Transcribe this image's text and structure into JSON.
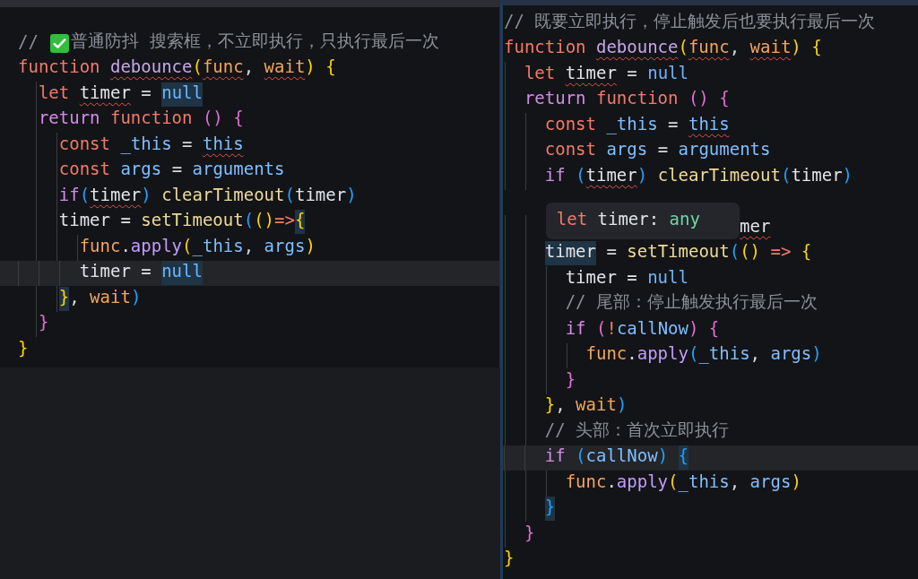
{
  "editors": [
    {
      "lines": [
        {
          "current": false,
          "tokens": [
            {
              "text": "// ",
              "kind": "comment",
              "squiggle": false,
              "highlighted": false
            },
            {
              "kind": "check",
              "squiggle": false,
              "highlighted": false
            },
            {
              "text": "普通防抖 搜索框，不立即执行，只执行最后一次",
              "kind": "comment",
              "squiggle": false,
              "highlighted": false
            }
          ]
        },
        {
          "current": false,
          "tokens": [
            {
              "text": "function ",
              "kind": "keyword",
              "squiggle": false,
              "highlighted": false
            },
            {
              "text": "debounce",
              "kind": "function",
              "squiggle": true,
              "highlighted": false
            },
            {
              "text": "(",
              "kind": "bracket1",
              "squiggle": false,
              "highlighted": false
            },
            {
              "text": "func",
              "kind": "param",
              "squiggle": true,
              "highlighted": false
            },
            {
              "text": ", ",
              "kind": "punct",
              "squiggle": false,
              "highlighted": false
            },
            {
              "text": "wait",
              "kind": "param",
              "squiggle": true,
              "highlighted": false
            },
            {
              "text": ") ",
              "kind": "bracket1",
              "squiggle": false,
              "highlighted": false
            },
            {
              "text": "{",
              "kind": "bracket1",
              "squiggle": false,
              "highlighted": false
            }
          ]
        },
        {
          "current": false,
          "tokens": [
            {
              "text": "  let ",
              "kind": "keyword",
              "squiggle": false,
              "highlighted": false
            },
            {
              "text": "timer",
              "kind": "variable",
              "squiggle": true,
              "highlighted": false
            },
            {
              "text": " = ",
              "kind": "punct",
              "squiggle": false,
              "highlighted": false
            },
            {
              "text": "null",
              "kind": "constant",
              "squiggle": false,
              "highlighted": true
            }
          ]
        },
        {
          "current": false,
          "tokens": [
            {
              "text": "  return ",
              "kind": "control",
              "squiggle": false,
              "highlighted": false
            },
            {
              "text": "function ",
              "kind": "keyword",
              "squiggle": false,
              "highlighted": false
            },
            {
              "text": "() ",
              "kind": "bracket2",
              "squiggle": false,
              "highlighted": false
            },
            {
              "text": "{",
              "kind": "bracket2",
              "squiggle": false,
              "highlighted": false
            }
          ]
        },
        {
          "current": false,
          "tokens": [
            {
              "text": "    const ",
              "kind": "keyword",
              "squiggle": false,
              "highlighted": false
            },
            {
              "text": "_this",
              "kind": "argument",
              "squiggle": false,
              "highlighted": false
            },
            {
              "text": " = ",
              "kind": "punct",
              "squiggle": false,
              "highlighted": false
            },
            {
              "text": "this",
              "kind": "argument",
              "squiggle": true,
              "highlighted": false
            }
          ]
        },
        {
          "current": false,
          "tokens": [
            {
              "text": "    const ",
              "kind": "keyword",
              "squiggle": false,
              "highlighted": false
            },
            {
              "text": "args",
              "kind": "argument",
              "squiggle": false,
              "highlighted": false
            },
            {
              "text": " = ",
              "kind": "punct",
              "squiggle": false,
              "highlighted": false
            },
            {
              "text": "arguments",
              "kind": "argument",
              "squiggle": false,
              "highlighted": false
            }
          ]
        },
        {
          "current": false,
          "tokens": [
            {
              "text": "    if",
              "kind": "control",
              "squiggle": false,
              "highlighted": false
            },
            {
              "text": "(",
              "kind": "bracket3",
              "squiggle": false,
              "highlighted": false
            },
            {
              "text": "timer",
              "kind": "variable",
              "squiggle": true,
              "highlighted": false
            },
            {
              "text": ") ",
              "kind": "bracket3",
              "squiggle": false,
              "highlighted": false
            },
            {
              "text": "clearTimeout",
              "kind": "call",
              "squiggle": false,
              "highlighted": false
            },
            {
              "text": "(",
              "kind": "bracket3",
              "squiggle": false,
              "highlighted": false
            },
            {
              "text": "timer",
              "kind": "variable",
              "squiggle": false,
              "highlighted": false
            },
            {
              "text": ")",
              "kind": "bracket3",
              "squiggle": false,
              "highlighted": false
            }
          ]
        },
        {
          "current": false,
          "tokens": [
            {
              "text": "    timer = ",
              "kind": "variable",
              "squiggle": false,
              "highlighted": false
            },
            {
              "text": "setTimeout",
              "kind": "call",
              "squiggle": false,
              "highlighted": false
            },
            {
              "text": "(",
              "kind": "bracket3",
              "squiggle": false,
              "highlighted": false
            },
            {
              "text": "()",
              "kind": "bracket1",
              "squiggle": false,
              "highlighted": false
            },
            {
              "text": "=>",
              "kind": "keyword",
              "squiggle": false,
              "highlighted": false
            },
            {
              "text": "{",
              "kind": "bracket1",
              "squiggle": false,
              "highlighted": true
            }
          ]
        },
        {
          "current": false,
          "tokens": [
            {
              "text": "      func",
              "kind": "param",
              "squiggle": false,
              "highlighted": false
            },
            {
              "text": ".",
              "kind": "punct",
              "squiggle": false,
              "highlighted": false
            },
            {
              "text": "apply",
              "kind": "method",
              "squiggle": false,
              "highlighted": false
            },
            {
              "text": "(",
              "kind": "bracket1",
              "squiggle": false,
              "highlighted": false
            },
            {
              "text": "_this",
              "kind": "argument",
              "squiggle": false,
              "highlighted": false
            },
            {
              "text": ", ",
              "kind": "punct",
              "squiggle": false,
              "highlighted": false
            },
            {
              "text": "args",
              "kind": "argument",
              "squiggle": false,
              "highlighted": false
            },
            {
              "text": ")",
              "kind": "bracket1",
              "squiggle": false,
              "highlighted": false
            }
          ]
        },
        {
          "current": true,
          "tokens": [
            {
              "text": "      timer = ",
              "kind": "variable",
              "squiggle": false,
              "highlighted": false
            },
            {
              "text": "null",
              "kind": "constant",
              "squiggle": false,
              "highlighted": true
            }
          ]
        },
        {
          "current": false,
          "tokens": [
            {
              "text": "    }",
              "kind": "bracket1",
              "squiggle": false,
              "highlighted": true
            },
            {
              "text": ", ",
              "kind": "punct",
              "squiggle": false,
              "highlighted": false
            },
            {
              "text": "wait",
              "kind": "param",
              "squiggle": false,
              "highlighted": false
            },
            {
              "text": ")",
              "kind": "bracket3",
              "squiggle": false,
              "highlighted": false
            }
          ]
        },
        {
          "current": false,
          "tokens": [
            {
              "text": "  }",
              "kind": "bracket2",
              "squiggle": false,
              "highlighted": false
            }
          ]
        },
        {
          "current": false,
          "tokens": [
            {
              "text": "}",
              "kind": "bracket1",
              "squiggle": false,
              "highlighted": false
            }
          ]
        }
      ]
    },
    {
      "lines": [
        {
          "current": false,
          "tokens": [
            {
              "text": "// 既要立即执行，停止触发后也要执行最后一次",
              "kind": "comment",
              "squiggle": false,
              "highlighted": false
            }
          ]
        },
        {
          "current": false,
          "tokens": [
            {
              "text": "function ",
              "kind": "keyword",
              "squiggle": false,
              "highlighted": false
            },
            {
              "text": "debounce",
              "kind": "function",
              "squiggle": true,
              "highlighted": false
            },
            {
              "text": "(",
              "kind": "bracket1",
              "squiggle": false,
              "highlighted": false
            },
            {
              "text": "func",
              "kind": "param",
              "squiggle": true,
              "highlighted": false
            },
            {
              "text": ", ",
              "kind": "punct",
              "squiggle": false,
              "highlighted": false
            },
            {
              "text": "wait",
              "kind": "param",
              "squiggle": true,
              "highlighted": false
            },
            {
              "text": ") ",
              "kind": "bracket1",
              "squiggle": false,
              "highlighted": false
            },
            {
              "text": "{",
              "kind": "bracket1",
              "squiggle": false,
              "highlighted": false
            }
          ]
        },
        {
          "current": false,
          "tokens": [
            {
              "text": "  let ",
              "kind": "keyword",
              "squiggle": false,
              "highlighted": false
            },
            {
              "text": "timer",
              "kind": "variable",
              "squiggle": true,
              "highlighted": false
            },
            {
              "text": " = ",
              "kind": "punct",
              "squiggle": false,
              "highlighted": false
            },
            {
              "text": "null",
              "kind": "constant",
              "squiggle": false,
              "highlighted": false
            }
          ]
        },
        {
          "current": false,
          "tokens": [
            {
              "text": "  return ",
              "kind": "control",
              "squiggle": false,
              "highlighted": false
            },
            {
              "text": "function ",
              "kind": "keyword",
              "squiggle": false,
              "highlighted": false
            },
            {
              "text": "() ",
              "kind": "bracket2",
              "squiggle": false,
              "highlighted": false
            },
            {
              "text": "{",
              "kind": "bracket2",
              "squiggle": false,
              "highlighted": false
            }
          ]
        },
        {
          "current": false,
          "tokens": [
            {
              "text": "    const ",
              "kind": "keyword",
              "squiggle": false,
              "highlighted": false
            },
            {
              "text": "_this",
              "kind": "argument",
              "squiggle": false,
              "highlighted": false
            },
            {
              "text": " = ",
              "kind": "punct",
              "squiggle": false,
              "highlighted": false
            },
            {
              "text": "this",
              "kind": "argument",
              "squiggle": true,
              "highlighted": false
            }
          ]
        },
        {
          "current": false,
          "tokens": [
            {
              "text": "    const ",
              "kind": "keyword",
              "squiggle": false,
              "highlighted": false
            },
            {
              "text": "args",
              "kind": "argument",
              "squiggle": false,
              "highlighted": false
            },
            {
              "text": " = ",
              "kind": "punct",
              "squiggle": false,
              "highlighted": false
            },
            {
              "text": "arguments",
              "kind": "argument",
              "squiggle": false,
              "highlighted": false
            }
          ]
        },
        {
          "current": false,
          "tokens": [
            {
              "text": "    if ",
              "kind": "control",
              "squiggle": false,
              "highlighted": false
            },
            {
              "text": "(",
              "kind": "bracket3",
              "squiggle": false,
              "highlighted": false
            },
            {
              "text": "timer",
              "kind": "variable",
              "squiggle": true,
              "highlighted": false
            },
            {
              "text": ") ",
              "kind": "bracket3",
              "squiggle": false,
              "highlighted": false
            },
            {
              "text": "clearTimeout",
              "kind": "call",
              "squiggle": false,
              "highlighted": false
            },
            {
              "text": "(",
              "kind": "bracket3",
              "squiggle": false,
              "highlighted": false
            },
            {
              "text": "timer",
              "kind": "variable",
              "squiggle": false,
              "highlighted": false
            },
            {
              "text": ")",
              "kind": "bracket3",
              "squiggle": false,
              "highlighted": false
            }
          ]
        },
        {
          "current": false
        },
        {
          "current": false,
          "tooltip": [
            {
              "text": "let ",
              "kind": "keyword"
            },
            {
              "text": "timer: ",
              "kind": "variable"
            },
            {
              "text": "any",
              "kind": "type"
            }
          ],
          "tokens": [
            {
              "text": "                       mer",
              "kind": "variable",
              "squiggle": true,
              "highlighted": false
            }
          ]
        },
        {
          "current": false,
          "tokens": [
            {
              "text": "    timer",
              "kind": "variable",
              "squiggle": false,
              "highlighted": true
            },
            {
              "text": " = ",
              "kind": "punct",
              "squiggle": false,
              "highlighted": false
            },
            {
              "text": "setTimeout",
              "kind": "call",
              "squiggle": false,
              "highlighted": false
            },
            {
              "text": "(",
              "kind": "bracket3",
              "squiggle": false,
              "highlighted": false
            },
            {
              "text": "() ",
              "kind": "bracket1",
              "squiggle": false,
              "highlighted": false
            },
            {
              "text": "=> ",
              "kind": "keyword",
              "squiggle": false,
              "highlighted": false
            },
            {
              "text": "{",
              "kind": "bracket1",
              "squiggle": false,
              "highlighted": false
            }
          ]
        },
        {
          "current": false,
          "tokens": [
            {
              "text": "      timer = ",
              "kind": "variable",
              "squiggle": false,
              "highlighted": false
            },
            {
              "text": "null",
              "kind": "constant",
              "squiggle": false,
              "highlighted": false
            }
          ]
        },
        {
          "current": false,
          "tokens": [
            {
              "text": "      // 尾部：停止触发执行最后一次",
              "kind": "comment",
              "squiggle": false,
              "highlighted": false
            }
          ]
        },
        {
          "current": false,
          "tokens": [
            {
              "text": "      if ",
              "kind": "control",
              "squiggle": false,
              "highlighted": false
            },
            {
              "text": "(",
              "kind": "bracket2",
              "squiggle": false,
              "highlighted": false
            },
            {
              "text": "!",
              "kind": "keyword",
              "squiggle": false,
              "highlighted": false
            },
            {
              "text": "callNow",
              "kind": "argument",
              "squiggle": false,
              "highlighted": false
            },
            {
              "text": ") ",
              "kind": "bracket2",
              "squiggle": false,
              "highlighted": false
            },
            {
              "text": "{",
              "kind": "bracket2",
              "squiggle": false,
              "highlighted": false
            }
          ]
        },
        {
          "current": false,
          "tokens": [
            {
              "text": "        func",
              "kind": "param",
              "squiggle": false,
              "highlighted": false
            },
            {
              "text": ".",
              "kind": "punct",
              "squiggle": false,
              "highlighted": false
            },
            {
              "text": "apply",
              "kind": "method",
              "squiggle": false,
              "highlighted": false
            },
            {
              "text": "(",
              "kind": "bracket3",
              "squiggle": false,
              "highlighted": false
            },
            {
              "text": "_this",
              "kind": "argument",
              "squiggle": false,
              "highlighted": false
            },
            {
              "text": ", ",
              "kind": "punct",
              "squiggle": false,
              "highlighted": false
            },
            {
              "text": "args",
              "kind": "argument",
              "squiggle": false,
              "highlighted": false
            },
            {
              "text": ")",
              "kind": "bracket3",
              "squiggle": false,
              "highlighted": false
            }
          ]
        },
        {
          "current": false,
          "tokens": [
            {
              "text": "      }",
              "kind": "bracket2",
              "squiggle": false,
              "highlighted": false
            }
          ]
        },
        {
          "current": false,
          "tokens": [
            {
              "text": "    }",
              "kind": "bracket1",
              "squiggle": false,
              "highlighted": false
            },
            {
              "text": ", ",
              "kind": "punct",
              "squiggle": false,
              "highlighted": false
            },
            {
              "text": "wait",
              "kind": "param",
              "squiggle": false,
              "highlighted": false
            },
            {
              "text": ")",
              "kind": "bracket3",
              "squiggle": false,
              "highlighted": false
            }
          ]
        },
        {
          "current": false,
          "tokens": [
            {
              "text": "    // 头部：首次立即执行",
              "kind": "comment",
              "squiggle": false,
              "highlighted": false
            }
          ]
        },
        {
          "current": true,
          "tokens": [
            {
              "text": "    if ",
              "kind": "control",
              "squiggle": false,
              "highlighted": false
            },
            {
              "text": "(",
              "kind": "bracket3",
              "squiggle": false,
              "highlighted": false
            },
            {
              "text": "callNow",
              "kind": "argument",
              "squiggle": false,
              "highlighted": false
            },
            {
              "text": ") ",
              "kind": "bracket3",
              "squiggle": false,
              "highlighted": false
            },
            {
              "text": "{",
              "kind": "bracket3",
              "squiggle": false,
              "highlighted": true
            }
          ]
        },
        {
          "current": false,
          "tokens": [
            {
              "text": "      func",
              "kind": "param",
              "squiggle": false,
              "highlighted": false
            },
            {
              "text": ".",
              "kind": "punct",
              "squiggle": false,
              "highlighted": false
            },
            {
              "text": "apply",
              "kind": "method",
              "squiggle": false,
              "highlighted": false
            },
            {
              "text": "(",
              "kind": "bracket1",
              "squiggle": false,
              "highlighted": false
            },
            {
              "text": "_this",
              "kind": "argument",
              "squiggle": false,
              "highlighted": false
            },
            {
              "text": ", ",
              "kind": "punct",
              "squiggle": false,
              "highlighted": false
            },
            {
              "text": "args",
              "kind": "argument",
              "squiggle": false,
              "highlighted": false
            },
            {
              "text": ")",
              "kind": "bracket1",
              "squiggle": false,
              "highlighted": false
            }
          ]
        },
        {
          "current": false,
          "tokens": [
            {
              "text": "    }",
              "kind": "bracket3",
              "squiggle": false,
              "highlighted": true
            }
          ]
        },
        {
          "current": false,
          "tokens": [
            {
              "text": "  }",
              "kind": "bracket2",
              "squiggle": false,
              "highlighted": false
            }
          ]
        },
        {
          "current": false,
          "tokens": [
            {
              "text": "}",
              "kind": "bracket1",
              "squiggle": false,
              "highlighted": false
            }
          ]
        }
      ]
    }
  ]
}
